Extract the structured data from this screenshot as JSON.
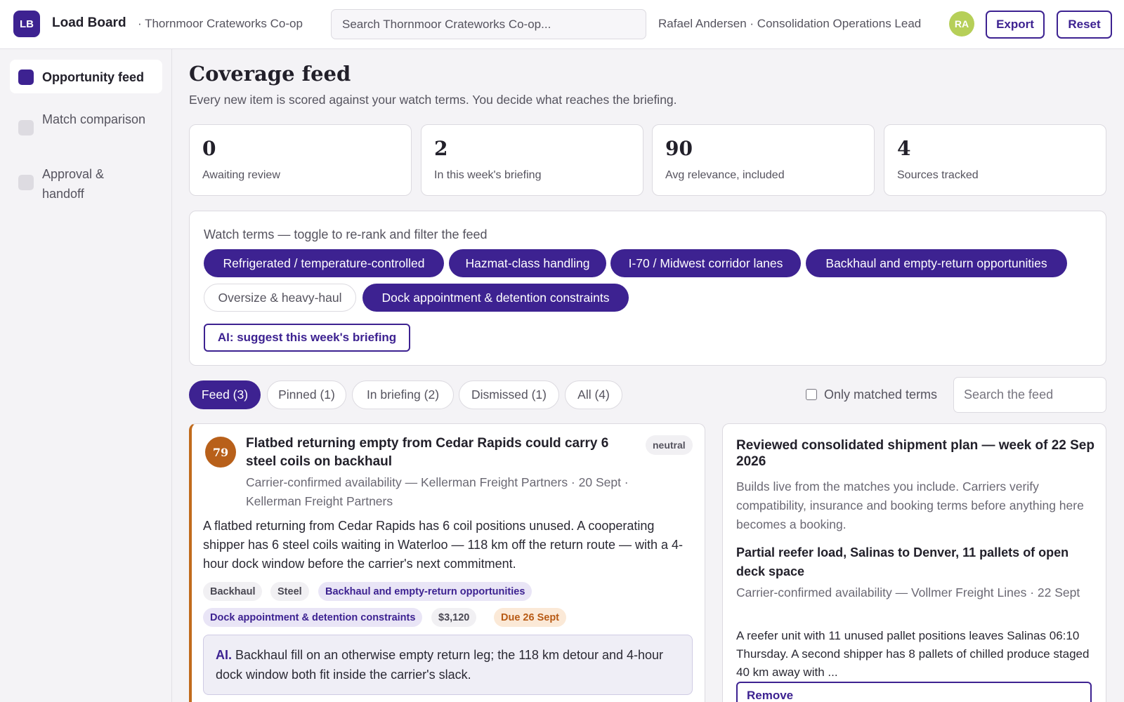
{
  "header": {
    "logo_text": "LB",
    "app_title": "Load Board",
    "org_name": "· Thornmoor Crateworks Co-op",
    "search_placeholder": "Search Thornmoor Crateworks Co-op...",
    "user_text": "Rafael Andersen · Consolidation Operations Lead",
    "avatar_initials": "RA",
    "export_label": "Export",
    "reset_label": "Reset"
  },
  "sidebar": {
    "items": [
      {
        "label": "Opportunity feed",
        "active": true
      },
      {
        "label": "Match comparison",
        "active": false
      },
      {
        "label": "Approval & handoff",
        "active": false
      }
    ]
  },
  "main": {
    "title": "Coverage feed",
    "subtitle": "Every new item is scored against your watch terms. You decide what reaches the briefing.",
    "stats": [
      {
        "value": "0",
        "label": "Awaiting review"
      },
      {
        "value": "2",
        "label": "In this week's briefing"
      },
      {
        "value": "90",
        "label": "Avg relevance, included"
      },
      {
        "value": "4",
        "label": "Sources tracked"
      }
    ],
    "watch": {
      "title": "Watch terms — toggle to re-rank and filter the feed",
      "terms": [
        {
          "label": "Refrigerated / temperature-controlled",
          "on": true
        },
        {
          "label": "Hazmat-class handling",
          "on": true
        },
        {
          "label": "I-70 / Midwest corridor lanes",
          "on": true
        },
        {
          "label": "Backhaul and empty-return opportunities",
          "on": true
        },
        {
          "label": "Oversize & heavy-haul",
          "on": false
        },
        {
          "label": "Dock appointment & detention constraints",
          "on": true
        }
      ],
      "ai_button": "AI: suggest this week's briefing"
    },
    "tabs": [
      {
        "label": "Feed (3)",
        "active": true
      },
      {
        "label": "Pinned (1)",
        "active": false
      },
      {
        "label": "In briefing (2)",
        "active": false
      },
      {
        "label": "Dismissed (1)",
        "active": false
      },
      {
        "label": "All (4)",
        "active": false
      }
    ],
    "only_matched_label": "Only matched terms",
    "feed_search_placeholder": "Search the feed"
  },
  "feed_card": {
    "score": "79",
    "title": "Flatbed returning empty from Cedar Rapids could carry 6 steel coils on backhaul",
    "sentiment": "neutral",
    "meta": "Carrier-confirmed availability — Kellerman Freight Partners · 20 Sept · Kellerman Freight Partners",
    "body": "A flatbed returning from Cedar Rapids has 6 coil positions unused. A cooperating shipper has 6 steel coils waiting in Waterloo — 118 km off the return route — with a 4-hour dock window before the carrier's next commitment.",
    "tags": [
      "Backhaul",
      "Steel",
      "Backhaul and empty-return opportunities",
      "Dock appointment & detention constraints",
      "$3,120",
      "Due 26 Sept"
    ],
    "ai_prefix": "AI.",
    "ai_text": "Backhaul fill on an otherwise empty return leg; the 118 km detour and 4-hour dock window both fit inside the carrier's slack."
  },
  "briefing": {
    "title": "Reviewed consolidated shipment plan — week of 22 Sep 2026",
    "description": "Builds live from the matches you include. Carriers verify compatibility, insurance and booking terms before anything here becomes a booking.",
    "item_title": "Partial reefer load, Salinas to Denver, 11 pallets of open deck space",
    "item_meta": "Carrier-confirmed availability — Vollmer Freight Lines · 22 Sept",
    "item_body": "A reefer unit with 11 unused pallet positions leaves Salinas 06:10 Thursday. A second shipper has 8 pallets of chilled produce staged 40 km away with ...",
    "remove_label": "Remove"
  },
  "colors": {
    "accent": "#3d2291",
    "score_orange": "#b8601a",
    "avatar_green": "#b6cf58"
  }
}
